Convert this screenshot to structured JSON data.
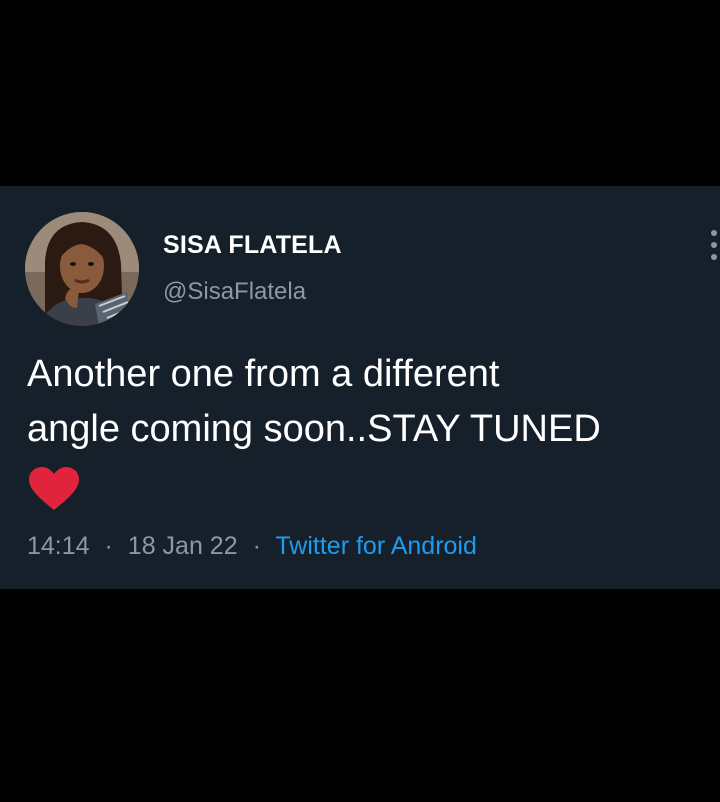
{
  "tweet": {
    "display_name": "SISA FLATELA",
    "handle": "@SisaFlatela",
    "text": "Another one from a different\nangle coming soon..STAY TUNED",
    "emoji": "red-heart",
    "time": "14:14",
    "date": "18 Jan 22",
    "separator": "·",
    "source": "Twitter for Android"
  },
  "colors": {
    "page_background": "#000000",
    "card_background": "#15202b",
    "text_primary": "#ffffff",
    "text_secondary": "#8b98a5",
    "link": "#1d9bf0",
    "heart": "#e0243b"
  },
  "icons": {
    "more": "more-vertical-icon",
    "heart": "heart-icon"
  }
}
